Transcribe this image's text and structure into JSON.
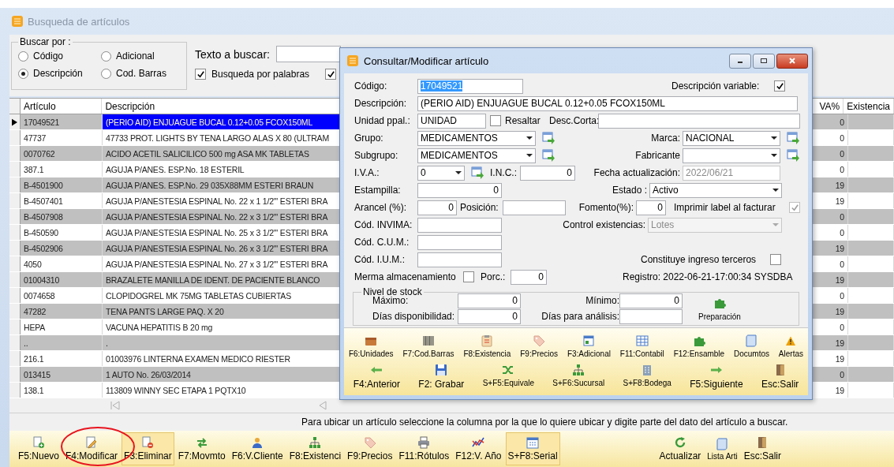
{
  "window": {
    "title": "Busqueda de artículos"
  },
  "search": {
    "group_title": "Buscar por :",
    "options": [
      {
        "label": "Código",
        "selected": false
      },
      {
        "label": "Adicional",
        "selected": false
      },
      {
        "label": "Descripción",
        "selected": true
      },
      {
        "label": "Cod. Barras",
        "selected": false
      }
    ],
    "text_label": "Texto a buscar:",
    "checkboxes": [
      {
        "label": "Busqueda por palabras",
        "checked": true
      },
      {
        "checked": true
      }
    ]
  },
  "table": {
    "columns": [
      "Artículo",
      "Descripción",
      "VA%",
      "Existencia"
    ],
    "rows": [
      {
        "code": "17049521",
        "description": "(PERIO AID) ENJUAGUE BUCAL 0.12+0.05 FCOX150ML",
        "iva": "0",
        "selected": true
      },
      {
        "code": "47737",
        "description": "47733 PROT. LIGHTS BY TENA LARGO ALAS X 80 (ULTRAM",
        "iva": "0",
        "selected": false
      },
      {
        "code": "0070762",
        "description": "ACIDO ACETIL SALICILICO 500 mg ASA MK  TABLETAS",
        "iva": "0",
        "selected": false
      },
      {
        "code": "387.1",
        "description": "AGUJA P/ANES. ESP.No. 18 ESTERIL",
        "iva": "0",
        "selected": false
      },
      {
        "code": "B-4501900",
        "description": "AGUJA P/ANES. ESP.No. 29  035X88MM ESTERI BRAUN",
        "iva": "19",
        "selected": false
      },
      {
        "code": "B-4507401",
        "description": "AGUJA P/ANESTESIA ESPINAL No. 22 x 1 1/2\"' ESTERI BRA",
        "iva": "19",
        "selected": false
      },
      {
        "code": "B-4507908",
        "description": "AGUJA P/ANESTESIA ESPINAL No. 22 x 3 1/2\"' ESTERI BRA",
        "iva": "0",
        "selected": false
      },
      {
        "code": "B-450590",
        "description": "AGUJA P/ANESTESIA ESPINAL No. 25 x 3 1/2\"' ESTERI BRA",
        "iva": "0",
        "selected": false
      },
      {
        "code": "B-4502906",
        "description": "AGUJA P/ANESTESIA ESPINAL No. 26 x 3 1/2\"' ESTERI BRA",
        "iva": "19",
        "selected": false
      },
      {
        "code": "4050",
        "description": "AGUJA P/ANESTESIA ESPINAL No. 27 x 3 1/2\"' ESTERI BRA",
        "iva": "0",
        "selected": false
      },
      {
        "code": "01004310",
        "description": "BRAZALETE MANILLA DE IDENT. DE PACIENTE BLANCO",
        "iva": "19",
        "selected": false
      },
      {
        "code": "0074658",
        "description": "CLOPIDOGREL MK 75MG TABLETAS CUBIERTAS",
        "iva": "0",
        "selected": false
      },
      {
        "code": "47282",
        "description": "TENA PANTS LARGE PAQ. X 20",
        "iva": "19",
        "selected": false
      },
      {
        "code": "HEPA",
        "description": "VACUNA HEPATITIS B 20 mg",
        "iva": "0",
        "selected": false
      },
      {
        "code": "..",
        "description": ".",
        "iva": "19",
        "selected": false
      },
      {
        "code": "216.1",
        "description": "01003976 LINTERNA EXAMEN MEDICO RIESTER",
        "iva": "19",
        "selected": false
      },
      {
        "code": "013415",
        "description": "1 AUTO No. 26/03/2014",
        "iva": "0",
        "selected": false
      },
      {
        "code": "138.1",
        "description": "113809 WINNY SEC ETAPA 1 PQTX10",
        "iva": "19",
        "selected": false
      }
    ]
  },
  "hint": "Para ubicar un artículo seleccione la columna por la que lo quiere ubicar y digite parte del dato del artículo a buscar.",
  "toolbar": [
    {
      "label": "F5:Nuevo",
      "highlighted": false
    },
    {
      "label": "F4:Modificar",
      "highlighted": false
    },
    {
      "label": "F3:Eliminar",
      "highlighted": true
    },
    {
      "label": "F7:Movmto",
      "highlighted": false
    },
    {
      "label": "F6:V.Cliente",
      "highlighted": false
    },
    {
      "label": "F8:Existenci",
      "highlighted": false
    },
    {
      "label": "F9:Precios",
      "highlighted": false
    },
    {
      "label": "F11:Rótulos",
      "highlighted": false
    },
    {
      "label": "F12:V. Año",
      "highlighted": false
    },
    {
      "label": "S+F8:Serial",
      "highlighted": true
    },
    {
      "label": "Actualizar",
      "highlighted": false
    },
    {
      "label": "Lista Arti",
      "highlighted": false
    },
    {
      "label": "Esc:Salir",
      "highlighted": false
    }
  ],
  "dialog": {
    "title": "Consultar/Modificar artículo",
    "form_rows": [
      [
        {
          "kind": "text",
          "label": "Código:",
          "value": "17049521",
          "disabled": false
        },
        {
          "kind": "checkbox",
          "label": "Descripción variable:",
          "checked": true,
          "disabled": false
        }
      ],
      [
        {
          "kind": "text",
          "label": "Descripción:",
          "value": "(PERIO AID) ENJUAGUE BUCAL 0.12+0.05 FCOX150ML",
          "disabled": false
        }
      ],
      [
        {
          "kind": "text",
          "label": "Unidad ppal.:",
          "value": "UNIDAD",
          "disabled": false
        },
        {
          "kind": "checkbox",
          "label": "Resaltar",
          "checked": false,
          "disabled": false
        },
        {
          "kind": "text",
          "label": "Desc.Corta:",
          "disabled": false
        }
      ],
      [
        {
          "kind": "select",
          "label": "Grupo:",
          "value": "MEDICAMENTOS",
          "disabled": false
        },
        {
          "kind": "select",
          "label": "Marca:",
          "value": "NACIONAL",
          "disabled": false
        }
      ],
      [
        {
          "kind": "select",
          "label": "Subgrupo:",
          "value": "MEDICAMENTOS",
          "disabled": false
        },
        {
          "kind": "select",
          "label": "Fabricante",
          "disabled": false
        }
      ],
      [
        {
          "kind": "select",
          "label": "I.V.A.:",
          "value": "0",
          "disabled": false
        },
        {
          "kind": "text",
          "label": "I.N.C.:",
          "value": "0",
          "disabled": false
        },
        {
          "kind": "text",
          "label": "Fecha actualización:",
          "value": "2022/06/21",
          "disabled": true
        }
      ],
      [
        {
          "kind": "text",
          "label": "Estampilla:",
          "value": "0",
          "disabled": false
        },
        {
          "kind": "select",
          "label": "Estado :",
          "value": "Activo",
          "disabled": false
        }
      ],
      [
        {
          "kind": "text",
          "label": "Arancel (%):",
          "value": "0",
          "disabled": false
        },
        {
          "kind": "text",
          "label": "Posición:",
          "disabled": false
        },
        {
          "kind": "text",
          "label": "Fomento(%):",
          "value": "0",
          "disabled": false
        },
        {
          "kind": "checkbox",
          "label": "Imprimir label al facturar",
          "checked": true,
          "disabled": true
        }
      ],
      [
        {
          "kind": "text",
          "label": "Cód. INVIMA:",
          "disabled": false
        },
        {
          "kind": "select",
          "label": "Control existencias:",
          "value": "Lotes",
          "disabled": true
        }
      ],
      [
        {
          "kind": "text",
          "label": "Cód. C.U.M.:",
          "disabled": false
        }
      ],
      [
        {
          "kind": "text",
          "label": "Cód. I.U.M.:",
          "disabled": false
        },
        {
          "kind": "checkbox",
          "label": "Constituye ingreso terceros",
          "checked": false,
          "disabled": false
        }
      ],
      [
        {
          "kind": "checkbox",
          "label": "Merma almacenamiento",
          "checked": false,
          "disabled": false
        },
        {
          "kind": "text",
          "label": "Porc.:",
          "value": "0",
          "disabled": false
        },
        {
          "kind": "note",
          "text": "Registro: 2022-06-21-17:00:34 SYSDBA"
        }
      ]
    ],
    "stock_group": {
      "title": "Nivel de stock",
      "fields": [
        {
          "label": "Máximo:",
          "value": "0"
        },
        {
          "label": "Mínimo:",
          "value": "0"
        },
        {
          "label": "Días disponibilidad:",
          "value": "0"
        },
        {
          "label": "Días para análisis:"
        }
      ],
      "button": "Preparación"
    },
    "toolbar_top": [
      "F6:Unidades",
      "F7:Cod.Barras",
      "F8:Existencia",
      "F9:Precios",
      "F3:Adicional",
      "F11:Contabil",
      "F12:Ensamble",
      "Documtos",
      "Alertas"
    ],
    "toolbar_bottom": [
      "F4:Anterior",
      "F2: Grabar",
      "S+F5:Equivale",
      "S+F6:Sucursal",
      "S+F8:Bodega",
      "F5:Siguiente",
      "Esc:Salir"
    ]
  }
}
